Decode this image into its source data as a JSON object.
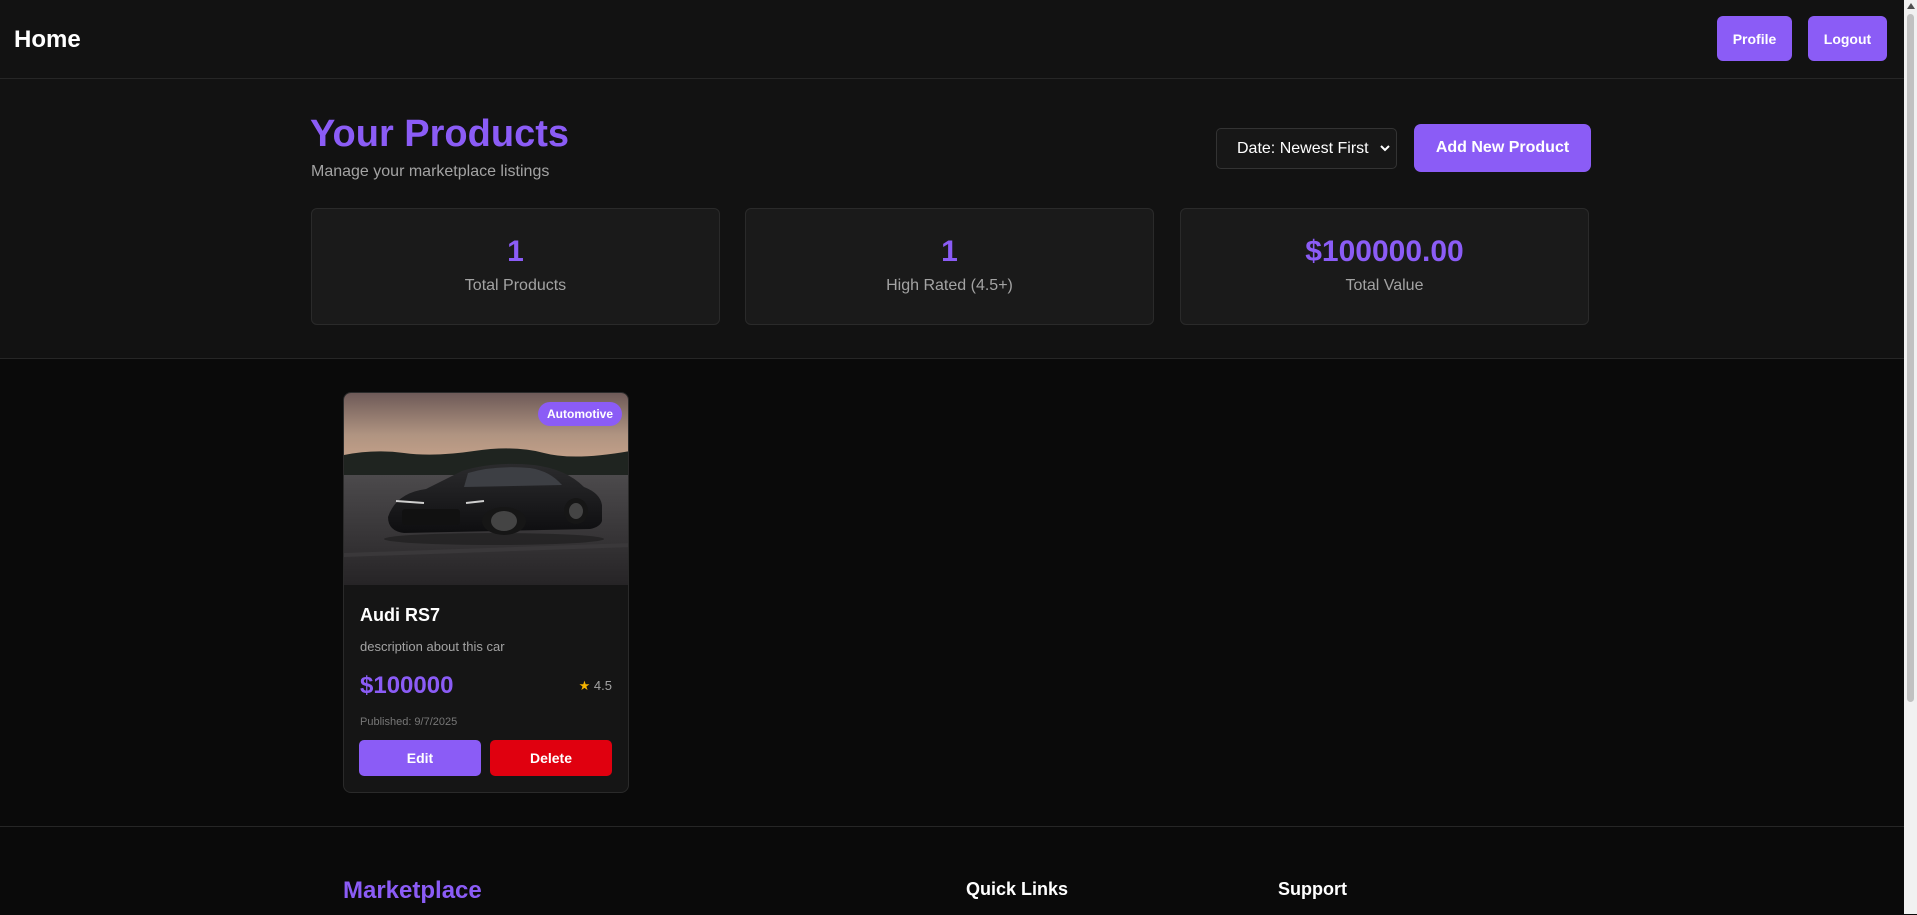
{
  "header": {
    "title": "Home",
    "profile_label": "Profile",
    "logout_label": "Logout"
  },
  "hero": {
    "title": "Your Products",
    "subtitle": "Manage your marketplace listings",
    "sort": {
      "selected": "Date: Newest First"
    },
    "add_label": "Add New Product"
  },
  "stats": [
    {
      "value": "1",
      "label": "Total Products"
    },
    {
      "value": "1",
      "label": "High Rated (4.5+)"
    },
    {
      "value": "$100000.00",
      "label": "Total Value"
    }
  ],
  "products": [
    {
      "badge": "Automotive",
      "title": "Audi RS7",
      "description": "description about this car",
      "price": "$100000",
      "rating": "4.5",
      "published": "Published: 9/7/2025",
      "edit_label": "Edit",
      "delete_label": "Delete"
    }
  ],
  "footer": {
    "brand": "Marketplace",
    "quick_links": "Quick Links",
    "support": "Support"
  },
  "icons": {
    "rating": "star-icon",
    "sort": "chevron-down-icon"
  },
  "colors": {
    "accent": "#8b5cf6",
    "danger": "#e0000f",
    "star": "#f5b400",
    "background": "#0a0a0a"
  }
}
